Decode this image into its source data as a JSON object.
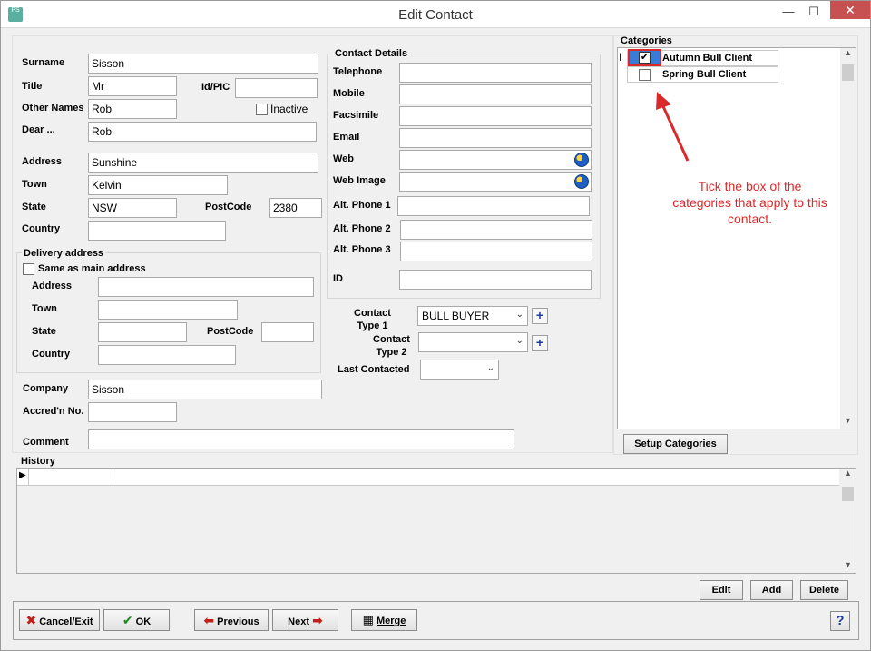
{
  "window": {
    "title": "Edit Contact",
    "app_icon_text": "PS",
    "minimize": "—",
    "maximize": "☐",
    "close": "✕"
  },
  "main": {
    "surname_label": "Surname",
    "surname_value": "Sisson",
    "title_label": "Title",
    "title_value": "Mr",
    "idpic_label": "Id/PIC",
    "idpic_value": "",
    "other_names_label": "Other Names",
    "other_names_value": "Rob",
    "inactive_label": "Inactive",
    "dear_label": "Dear ...",
    "dear_value": "Rob",
    "address_label": "Address",
    "address_value": "Sunshine",
    "town_label": "Town",
    "town_value": "Kelvin",
    "state_label": "State",
    "state_value": "NSW",
    "postcode_label": "PostCode",
    "postcode_value": "2380",
    "country_label": "Country",
    "country_value": ""
  },
  "delivery": {
    "group_label": "Delivery address",
    "same_as_main_label": "Same as main address",
    "address_label": "Address",
    "town_label": "Town",
    "state_label": "State",
    "postcode_label": "PostCode",
    "country_label": "Country"
  },
  "company": {
    "company_label": "Company",
    "company_value": "Sisson",
    "accred_label": "Accred'n No.",
    "accred_value": "",
    "comment_label": "Comment",
    "comment_value": ""
  },
  "contact_details": {
    "group_label": "Contact Details",
    "telephone_label": "Telephone",
    "mobile_label": "Mobile",
    "facsimile_label": "Facsimile",
    "email_label": "Email",
    "web_label": "Web",
    "web_image_label": "Web Image",
    "alt1_label": "Alt. Phone 1",
    "alt2_label": "Alt. Phone 2",
    "alt3_label": "Alt. Phone 3",
    "id_label": "ID"
  },
  "contact_type": {
    "type1_label_line1": "Contact",
    "type1_label_line2": "Type 1",
    "type1_value": "BULL BUYER",
    "type2_label_line1": "Contact",
    "type2_label_line2": "Type 2",
    "type2_value": "",
    "last_contacted_label": "Last Contacted",
    "last_contacted_value": "",
    "plus": "+"
  },
  "categories": {
    "group_label": "Categories",
    "items": [
      {
        "label": "Autumn Bull Client",
        "checked": true
      },
      {
        "label": "Spring Bull Client",
        "checked": false
      }
    ],
    "check_mark": "✔",
    "setup_button": "Setup Categories",
    "annotation": "Tick the box of the categories that apply to this contact.",
    "annotation_color": "#d92a2a"
  },
  "history": {
    "label": "History",
    "row_marker": "▶",
    "edit_button": "Edit",
    "add_button": "Add",
    "delete_button": "Delete"
  },
  "footer": {
    "cancel_label": "Cancel/Exit",
    "ok_label": "OK",
    "previous_label": "Previous",
    "next_label": "Next",
    "merge_label": "Merge",
    "help_label": "?",
    "cancel_icon": "✖",
    "ok_icon": "✔",
    "previous_icon": "⬅",
    "next_icon": "➡",
    "merge_icon": "▦"
  },
  "scroll": {
    "up": "▲",
    "down": "▼"
  }
}
